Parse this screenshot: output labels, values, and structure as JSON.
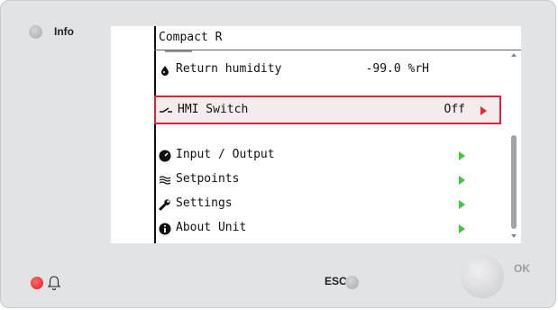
{
  "panel": {
    "info_label": "Info",
    "esc_label": "ESC",
    "ok_label": "OK"
  },
  "screen": {
    "title": "Compact R",
    "rows": [
      {
        "icon": "drop-icon",
        "label": "Return humidity",
        "value": "-99.0 %rH"
      },
      {
        "icon": "switch-icon",
        "label": "HMI Switch",
        "value": "Off",
        "selected": true
      },
      {
        "icon": "gauge-icon",
        "label": "Input / Output"
      },
      {
        "icon": "setpoints-icon",
        "label": "Setpoints"
      },
      {
        "icon": "wrench-icon",
        "label": "Settings"
      },
      {
        "icon": "info-circle-icon",
        "label": "About Unit"
      }
    ]
  },
  "colors": {
    "panel_bg": "#e2e3e5",
    "highlight_border": "#d9243b",
    "highlight_bg": "#f4eceb",
    "arrow_green": "#3cc83c",
    "alarm_red": "#d81f1f"
  }
}
